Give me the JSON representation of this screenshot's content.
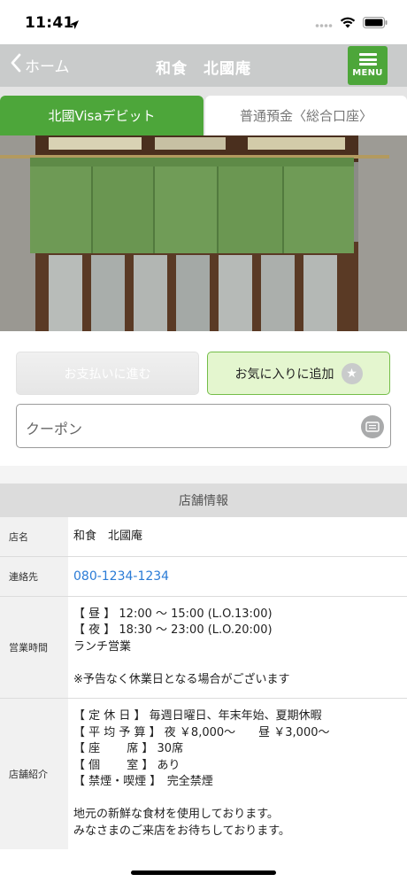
{
  "status": {
    "time": "11:41"
  },
  "nav": {
    "back_label": "ホーム",
    "title": "和食　北國庵",
    "menu_label": "MENU"
  },
  "tabs": [
    {
      "label": "北國Visaデビット",
      "active": true
    },
    {
      "label": "普通預金〈総合口座〉",
      "active": false
    }
  ],
  "actions": {
    "pay_label": "お支払いに進む",
    "favorite_label": "お気に入りに追加",
    "coupon_placeholder": "クーポン"
  },
  "store_info": {
    "header": "店舗情報",
    "rows": {
      "name": {
        "label": "店名",
        "value": "和食　北國庵"
      },
      "contact": {
        "label": "連絡先",
        "value": "080-1234-1234"
      },
      "hours": {
        "label": "営業時間",
        "lines": [
          "【 昼 】 12:00 ～ 15:00 (L.O.13:00)",
          "【 夜 】 18:30 ～ 23:00 (L.O.20:00)",
          "ランチ営業",
          "",
          "※予告なく休業日となる場合がございます"
        ]
      },
      "intro": {
        "label": "店舗紹介",
        "lines": [
          "【 定 休 日 】 毎週日曜日、年末年始、夏期休暇",
          "【 平 均 予 算 】 夜 ￥8,000～　　昼 ￥3,000～",
          "【 座　　 席 】 30席",
          "【 個　　 室 】 あり",
          "【 禁煙・喫煙 】　完全禁煙",
          "",
          "地元の新鮮な食材を使用しております。",
          "みなさまのご来店をお待ちしております。"
        ]
      }
    }
  },
  "colors": {
    "accent_green": "#4da63a",
    "nav_gray": "#c9cbcb",
    "link_blue": "#2a7bd6"
  }
}
